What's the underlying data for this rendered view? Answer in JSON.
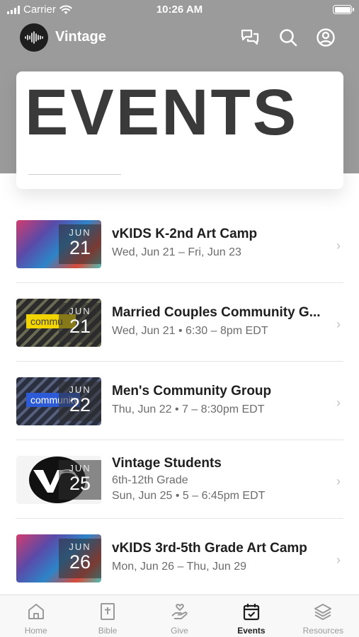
{
  "status_bar": {
    "carrier": "Carrier",
    "time": "10:26 AM"
  },
  "app_bar": {
    "title": "Vintage"
  },
  "hero": {
    "title": "EVENTS"
  },
  "events": [
    {
      "month": "JUN",
      "day": "21",
      "title": "vKIDS K-2nd Art Camp",
      "lines": [
        "Wed, Jun 21 – Fri, Jun 23"
      ],
      "thumb": "art"
    },
    {
      "month": "JUN",
      "day": "21",
      "title": "Married Couples Community G...",
      "lines": [
        "Wed, Jun 21 • 6:30 – 8pm EDT"
      ],
      "thumb": "yellow",
      "thumb_text": "commu"
    },
    {
      "month": "JUN",
      "day": "22",
      "title": "Men's Community Group",
      "lines": [
        "Thu, Jun 22 • 7 – 8:30pm EDT"
      ],
      "thumb": "blue",
      "thumb_text": "community"
    },
    {
      "month": "JUN",
      "day": "25",
      "title": "Vintage Students",
      "lines": [
        "6th-12th Grade",
        "Sun, Jun 25 • 5 – 6:45pm EDT"
      ],
      "thumb": "logo"
    },
    {
      "month": "JUN",
      "day": "26",
      "title": "vKIDS 3rd-5th Grade Art Camp",
      "lines": [
        "Mon, Jun 26 – Thu, Jun 29"
      ],
      "thumb": "art"
    }
  ],
  "tabs": [
    {
      "label": "Home",
      "icon": "home-icon",
      "active": false
    },
    {
      "label": "Bible",
      "icon": "bible-icon",
      "active": false
    },
    {
      "label": "Give",
      "icon": "give-icon",
      "active": false
    },
    {
      "label": "Events",
      "icon": "calendar-icon",
      "active": true
    },
    {
      "label": "Resources",
      "icon": "resources-icon",
      "active": false
    }
  ],
  "colors": {
    "header": "#9b9b9b",
    "accent_yellow": "#f2d400",
    "accent_blue": "#2d5bd8"
  }
}
